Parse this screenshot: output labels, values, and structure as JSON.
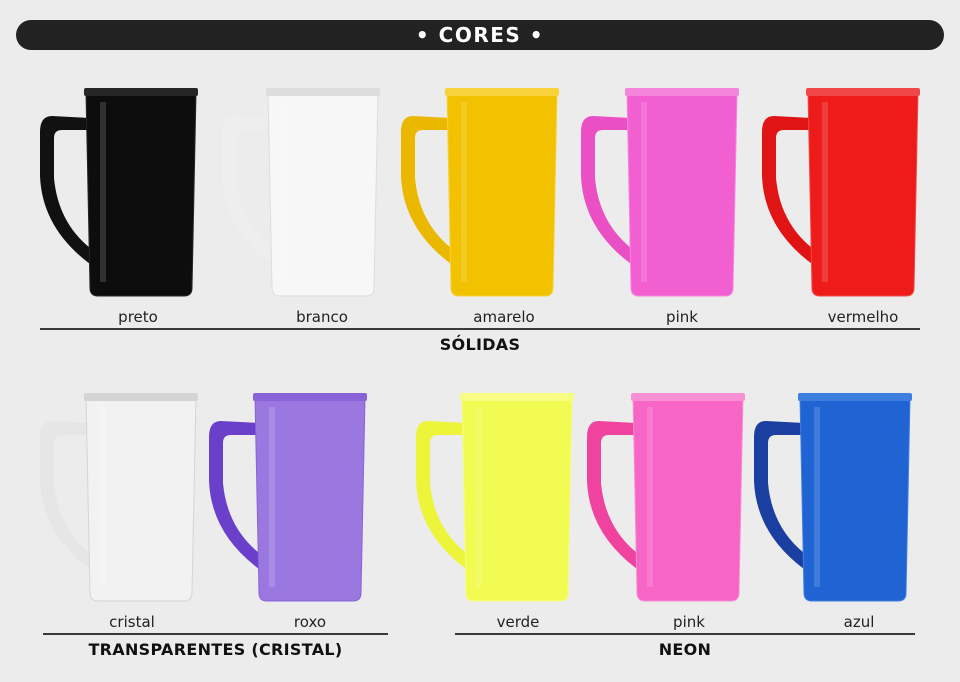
{
  "header": {
    "title": "• CORES •"
  },
  "sections": {
    "solidas": {
      "title": "SÓLIDAS",
      "items": [
        {
          "label": "preto",
          "color": "#0d0d0d",
          "handle": "#111111",
          "rim": "#262626"
        },
        {
          "label": "branco",
          "color": "#f7f7f7",
          "handle": "#eeeeee",
          "rim": "#dddddd"
        },
        {
          "label": "amarelo",
          "color": "#f2c200",
          "handle": "#eab800",
          "rim": "#f7d23a"
        },
        {
          "label": "pink",
          "color": "#f25fd0",
          "handle": "#ea50c4",
          "rim": "#f585dc"
        },
        {
          "label": "vermelho",
          "color": "#ee1b1b",
          "handle": "#e01414",
          "rim": "#f04848"
        }
      ]
    },
    "transparentes": {
      "title": "TRANSPARENTES (CRISTAL)",
      "items": [
        {
          "label": "cristal",
          "color": "#f2f2f2",
          "handle": "#e6e6e6",
          "rim": "#d4d4d4"
        },
        {
          "label": "roxo",
          "color": "#9a78e0",
          "handle": "#6a3fc9",
          "rim": "#8a62d8"
        }
      ]
    },
    "neon": {
      "title": "NEON",
      "items": [
        {
          "label": "verde",
          "color": "#f2fb52",
          "handle": "#ecf53a",
          "rim": "#f6fc84"
        },
        {
          "label": "pink",
          "color": "#f765c6",
          "handle": "#f0429f",
          "rim": "#f98fd5"
        },
        {
          "label": "azul",
          "color": "#1f64d2",
          "handle": "#1b3fa0",
          "rim": "#3d7ee0"
        }
      ]
    }
  }
}
